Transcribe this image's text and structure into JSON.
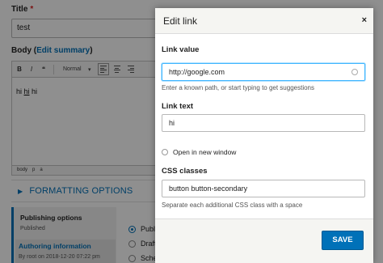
{
  "node_form": {
    "title_label": "Title",
    "title_required_marker": "*",
    "title_value": "test",
    "body_label": "Body (",
    "body_edit_summary": "Edit summary",
    "body_label_close": ")",
    "toolbar": {
      "bold": "B",
      "italic": "I",
      "blockquote": "❝",
      "format_select": "Normal"
    },
    "editor_text_before": "hi ",
    "editor_link_text": "hi",
    "editor_text_after": " hi",
    "element_path": [
      "body",
      "p",
      "a"
    ],
    "formatting_options": "FORMATTING OPTIONS",
    "sidebar": {
      "publishing_title": "Publishing options",
      "publishing_status": "Published",
      "authoring_title": "Authoring information",
      "authoring_sub": "By root on 2018-12-20 07:22 pm"
    },
    "radios": [
      {
        "label": "Publi",
        "checked": true
      },
      {
        "label": "Draft",
        "checked": false
      },
      {
        "label": "Schedule for later",
        "checked": false
      }
    ]
  },
  "dialog": {
    "title": "Edit link",
    "close_glyph": "×",
    "link_value_label": "Link value",
    "link_value": "http://google.com",
    "link_value_help": "Enter a known path, or start typing to get suggestions",
    "link_text_label": "Link text",
    "link_text": "hi",
    "new_window_label": "Open in new window",
    "css_classes_label": "CSS classes",
    "css_classes_value": "button button-secondary",
    "css_classes_help": "Separate each additional CSS class with a space",
    "save_label": "SAVE"
  },
  "colors": {
    "accent": "#0071b8",
    "required": "#dc2323",
    "overlay": "rgba(0,0,0,0.44)",
    "focus": "#40b6ff"
  }
}
